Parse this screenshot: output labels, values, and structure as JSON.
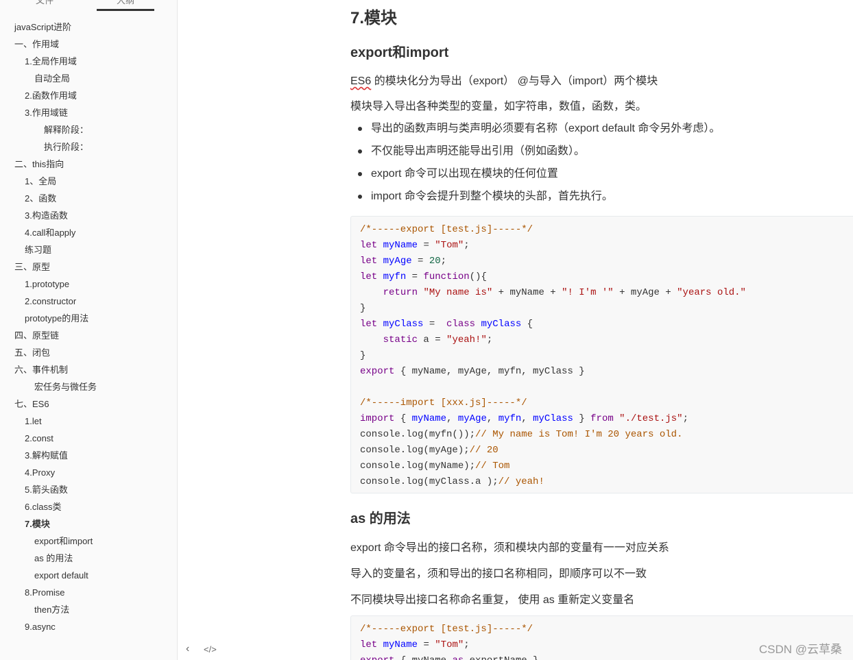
{
  "sidebar": {
    "tabs": [
      {
        "label": "文件",
        "active": false
      },
      {
        "label": "大纲",
        "active": true
      }
    ],
    "outline": [
      {
        "label": "javaScript进阶",
        "level": 1
      },
      {
        "label": "一、作用域",
        "level": 1
      },
      {
        "label": "1.全局作用域",
        "level": 2
      },
      {
        "label": "自动全局",
        "level": 3
      },
      {
        "label": "2.函数作用域",
        "level": 2
      },
      {
        "label": "3.作用域链",
        "level": 2
      },
      {
        "label": "解释阶段：",
        "level": 4
      },
      {
        "label": "执行阶段：",
        "level": 4
      },
      {
        "label": "二、this指向",
        "level": 1
      },
      {
        "label": "1、全局",
        "level": 2
      },
      {
        "label": "2、函数",
        "level": 2
      },
      {
        "label": "3.构造函数",
        "level": 2
      },
      {
        "label": "4.call和apply",
        "level": 2
      },
      {
        "label": "练习题",
        "level": 2
      },
      {
        "label": "三、原型",
        "level": 1
      },
      {
        "label": "1.prototype",
        "level": 2
      },
      {
        "label": "2.constructor",
        "level": 2
      },
      {
        "label": "prototype的用法",
        "level": 2
      },
      {
        "label": "四、原型链",
        "level": 1
      },
      {
        "label": "五、闭包",
        "level": 1
      },
      {
        "label": "六、事件机制",
        "level": 1
      },
      {
        "label": "宏任务与微任务",
        "level": 3
      },
      {
        "label": "七、ES6",
        "level": 1
      },
      {
        "label": "1.let",
        "level": 2
      },
      {
        "label": "2.const",
        "level": 2
      },
      {
        "label": "3.解构赋值",
        "level": 2
      },
      {
        "label": "4.Proxy",
        "level": 2
      },
      {
        "label": "5.箭头函数",
        "level": 2
      },
      {
        "label": "6.class类",
        "level": 2
      },
      {
        "label": "7.模块",
        "level": 2,
        "active": true
      },
      {
        "label": "export和import",
        "level": 3
      },
      {
        "label": "as 的用法",
        "level": 3
      },
      {
        "label": "export default",
        "level": 3
      },
      {
        "label": "8.Promise",
        "level": 2
      },
      {
        "label": "then方法",
        "level": 3
      },
      {
        "label": "9.async",
        "level": 2
      }
    ],
    "footer_icons": [
      "chevron-left-icon",
      "source-code-icon"
    ],
    "footer_glyphs": {
      "collapse": "‹",
      "source": "</>"
    }
  },
  "content": {
    "title": "7.模块",
    "section1": {
      "heading": "export和import",
      "para1_es6": "ES6",
      "para1_rest": " 的模块化分为导出（export） @与导入（import）两个模块",
      "para2": "模块导入导出各种类型的变量，如字符串，数值，函数，类。",
      "bullets": [
        "导出的函数声明与类声明必须要有名称（export default 命令另外考虑）。",
        "不仅能导出声明还能导出引用（例如函数）。",
        "export 命令可以出现在模块的任何位置",
        "import 命令会提升到整个模块的头部，首先执行。"
      ]
    },
    "code1": [
      [
        [
          "comment",
          "/*-----export [test.js]-----*/"
        ]
      ],
      [
        [
          "keyword",
          "let"
        ],
        [
          "plain",
          " "
        ],
        [
          "def",
          "myName"
        ],
        [
          "plain",
          " = "
        ],
        [
          "string",
          "\"Tom\""
        ],
        [
          "plain",
          ";"
        ]
      ],
      [
        [
          "keyword",
          "let"
        ],
        [
          "plain",
          " "
        ],
        [
          "def",
          "myAge"
        ],
        [
          "plain",
          " = "
        ],
        [
          "number",
          "20"
        ],
        [
          "plain",
          ";"
        ]
      ],
      [
        [
          "keyword",
          "let"
        ],
        [
          "plain",
          " "
        ],
        [
          "def",
          "myfn"
        ],
        [
          "plain",
          " = "
        ],
        [
          "keyword",
          "function"
        ],
        [
          "plain",
          "(){"
        ]
      ],
      [
        [
          "plain",
          "    "
        ],
        [
          "keyword",
          "return"
        ],
        [
          "plain",
          " "
        ],
        [
          "string",
          "\"My name is\""
        ],
        [
          "plain",
          " + myName + "
        ],
        [
          "string",
          "\"! I'm '\""
        ],
        [
          "plain",
          " + myAge + "
        ],
        [
          "string",
          "\"years old.\""
        ]
      ],
      [
        [
          "plain",
          "}"
        ]
      ],
      [
        [
          "keyword",
          "let"
        ],
        [
          "plain",
          " "
        ],
        [
          "def",
          "myClass"
        ],
        [
          "plain",
          " =  "
        ],
        [
          "keyword",
          "class"
        ],
        [
          "plain",
          " "
        ],
        [
          "def",
          "myClass"
        ],
        [
          "plain",
          " {"
        ]
      ],
      [
        [
          "plain",
          "    "
        ],
        [
          "keyword",
          "static"
        ],
        [
          "plain",
          " a = "
        ],
        [
          "string",
          "\"yeah!\""
        ],
        [
          "plain",
          ";"
        ]
      ],
      [
        [
          "plain",
          "}"
        ]
      ],
      [
        [
          "keyword",
          "export"
        ],
        [
          "plain",
          " { myName, myAge, myfn, myClass }"
        ]
      ],
      [
        [
          "plain",
          " "
        ]
      ],
      [
        [
          "comment",
          "/*-----import [xxx.js]-----*/"
        ]
      ],
      [
        [
          "keyword",
          "import"
        ],
        [
          "plain",
          " { "
        ],
        [
          "def",
          "myName"
        ],
        [
          "plain",
          ", "
        ],
        [
          "def",
          "myAge"
        ],
        [
          "plain",
          ", "
        ],
        [
          "def",
          "myfn"
        ],
        [
          "plain",
          ", "
        ],
        [
          "def",
          "myClass"
        ],
        [
          "plain",
          " } "
        ],
        [
          "keyword",
          "from"
        ],
        [
          "plain",
          " "
        ],
        [
          "string",
          "\"./test.js\""
        ],
        [
          "plain",
          ";"
        ]
      ],
      [
        [
          "plain",
          "console.log(myfn());"
        ],
        [
          "comment",
          "// My name is Tom! I'm 20 years old."
        ]
      ],
      [
        [
          "plain",
          "console.log(myAge);"
        ],
        [
          "comment",
          "// 20"
        ]
      ],
      [
        [
          "plain",
          "console.log(myName);"
        ],
        [
          "comment",
          "// Tom"
        ]
      ],
      [
        [
          "plain",
          "console.log(myClass.a );"
        ],
        [
          "comment",
          "// yeah!"
        ]
      ]
    ],
    "section2": {
      "heading": "as 的用法",
      "paras": [
        "export 命令导出的接口名称，须和模块内部的变量有一一对应关系",
        "导入的变量名，须和导出的接口名称相同，即顺序可以不一致",
        "不同模块导出接口名称命名重复， 使用 as 重新定义变量名"
      ]
    },
    "code2": [
      [
        [
          "comment",
          "/*-----export [test.js]-----*/"
        ]
      ],
      [
        [
          "keyword",
          "let"
        ],
        [
          "plain",
          " "
        ],
        [
          "def",
          "myName"
        ],
        [
          "plain",
          " = "
        ],
        [
          "string",
          "\"Tom\""
        ],
        [
          "plain",
          ";"
        ]
      ],
      [
        [
          "keyword",
          "export"
        ],
        [
          "plain",
          " { myName "
        ],
        [
          "keyword",
          "as"
        ],
        [
          "plain",
          " exportName }"
        ]
      ]
    ]
  },
  "watermark": "CSDN @云草桑",
  "colors": {
    "comment": "#aa5500",
    "keyword": "#770088",
    "def": "#0000ff",
    "string": "#aa1111",
    "number": "#116644"
  }
}
